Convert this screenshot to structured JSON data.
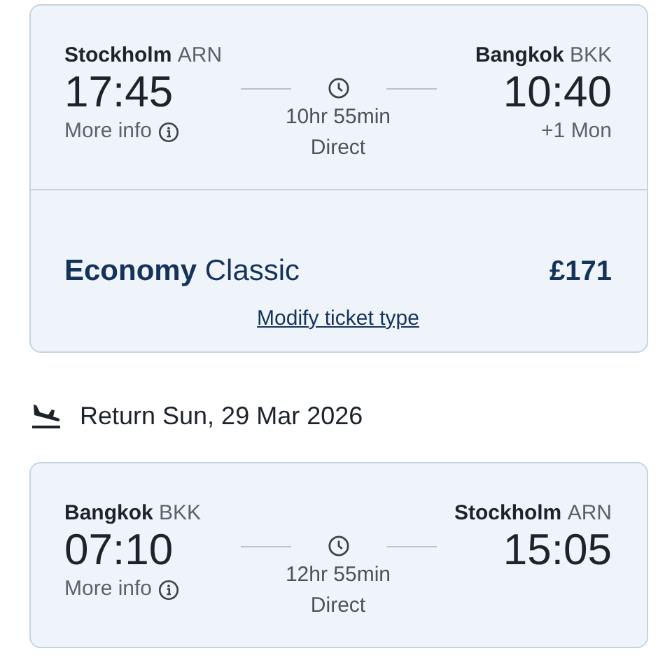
{
  "outbound": {
    "from": {
      "city": "Stockholm",
      "code": "ARN",
      "time": "17:45"
    },
    "to": {
      "city": "Bangkok",
      "code": "BKK",
      "time": "10:40",
      "day_offset": "+1 Mon"
    },
    "more_info": "More info",
    "duration": "10hr 55min",
    "stops": "Direct",
    "fare": {
      "cabin": "Economy",
      "type": "Classic",
      "price": "£171",
      "modify_link": "Modify ticket type"
    }
  },
  "return_header": {
    "label": "Return Sun, 29 Mar 2026"
  },
  "return": {
    "from": {
      "city": "Bangkok",
      "code": "BKK",
      "time": "07:10"
    },
    "to": {
      "city": "Stockholm",
      "code": "ARN",
      "time": "15:05"
    },
    "more_info": "More info",
    "duration": "12hr 55min",
    "stops": "Direct"
  }
}
